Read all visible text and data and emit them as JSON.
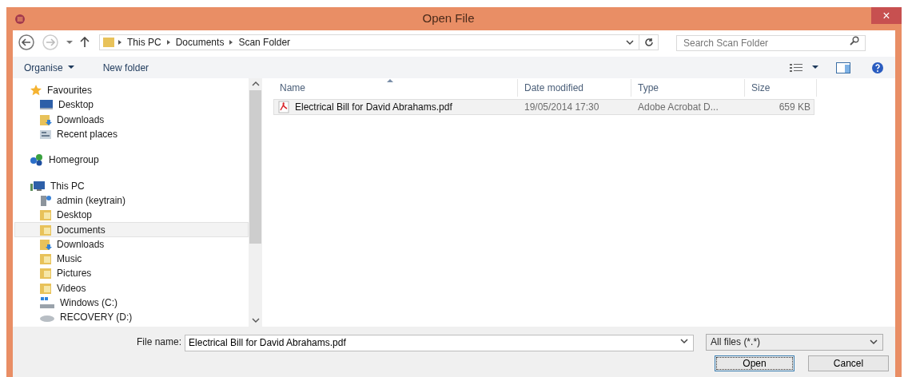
{
  "window": {
    "title": "Open File",
    "close": "×"
  },
  "address": {
    "segments": [
      "This PC",
      "Documents",
      "Scan Folder"
    ]
  },
  "search": {
    "placeholder": "Search Scan Folder"
  },
  "commands": {
    "organise": "Organise",
    "new_folder": "New folder"
  },
  "nav": [
    {
      "label": "Favourites",
      "kind": "section",
      "selected": false
    },
    {
      "label": "Desktop",
      "kind": "item",
      "selected": false
    },
    {
      "label": "Downloads",
      "kind": "item",
      "selected": false
    },
    {
      "label": "Recent places",
      "kind": "item",
      "selected": false
    },
    {
      "label": "Homegroup",
      "kind": "section",
      "selected": false
    },
    {
      "label": "This PC",
      "kind": "section",
      "selected": false
    },
    {
      "label": "admin (keytrain)",
      "kind": "item",
      "selected": false
    },
    {
      "label": "Desktop",
      "kind": "item",
      "selected": false
    },
    {
      "label": "Documents",
      "kind": "item",
      "selected": true
    },
    {
      "label": "Downloads",
      "kind": "item",
      "selected": false
    },
    {
      "label": "Music",
      "kind": "item",
      "selected": false
    },
    {
      "label": "Pictures",
      "kind": "item",
      "selected": false
    },
    {
      "label": "Videos",
      "kind": "item",
      "selected": false
    },
    {
      "label": "Windows (C:)",
      "kind": "item",
      "selected": false
    },
    {
      "label": "RECOVERY (D:)",
      "kind": "item",
      "selected": false
    }
  ],
  "table": {
    "columns": [
      "Name",
      "Date modified",
      "Type",
      "Size"
    ],
    "rows": [
      {
        "name": "Electrical Bill for David Abrahams.pdf",
        "date": "19/05/2014 17:30",
        "type": "Adobe Acrobat D...",
        "size": "659 KB",
        "selected": true
      }
    ]
  },
  "footer": {
    "file_name_label": "File name:",
    "file_name": "Electrical Bill for David Abrahams.pdf",
    "filter": "All files (*.*)",
    "open": "Open",
    "cancel": "Cancel"
  }
}
